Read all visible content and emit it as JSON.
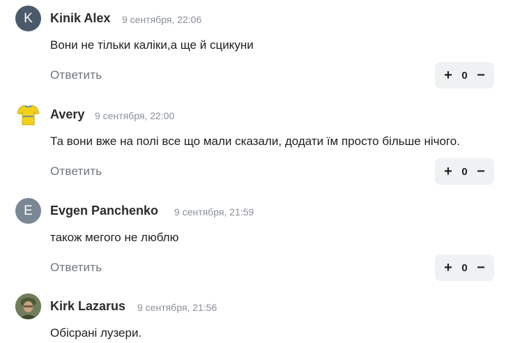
{
  "reply_label": "Ответить",
  "vote_plus": "+",
  "vote_minus": "−",
  "comments": [
    {
      "avatar_letter": "K",
      "avatar_color": "#4a5a6a",
      "author": "Kinik Alex",
      "date": "9 сентября, 22:06",
      "text": "Вони не тільки каліки,а ще й сцикуни",
      "score": "0"
    },
    {
      "avatar_icon": "tshirt-icon",
      "avatar_color": "#f2d11b",
      "author": "Avery",
      "date": "9 сентября, 22:00",
      "text": "Та вони вже на полі все що мали сказали, додати їм  просто більше нічого.",
      "score": "0"
    },
    {
      "avatar_letter": "E",
      "avatar_color": "#7a8896",
      "author": "Evgen Panchenko",
      "date": "9 сентября, 21:59",
      "text": "також мегого не люблю",
      "score": "0"
    },
    {
      "avatar_icon": "user-photo-icon",
      "avatar_color": "#5b6b45",
      "author": "Kirk Lazarus",
      "date": "9 сентября, 21:56",
      "text": "Обісрані лузери."
    }
  ]
}
